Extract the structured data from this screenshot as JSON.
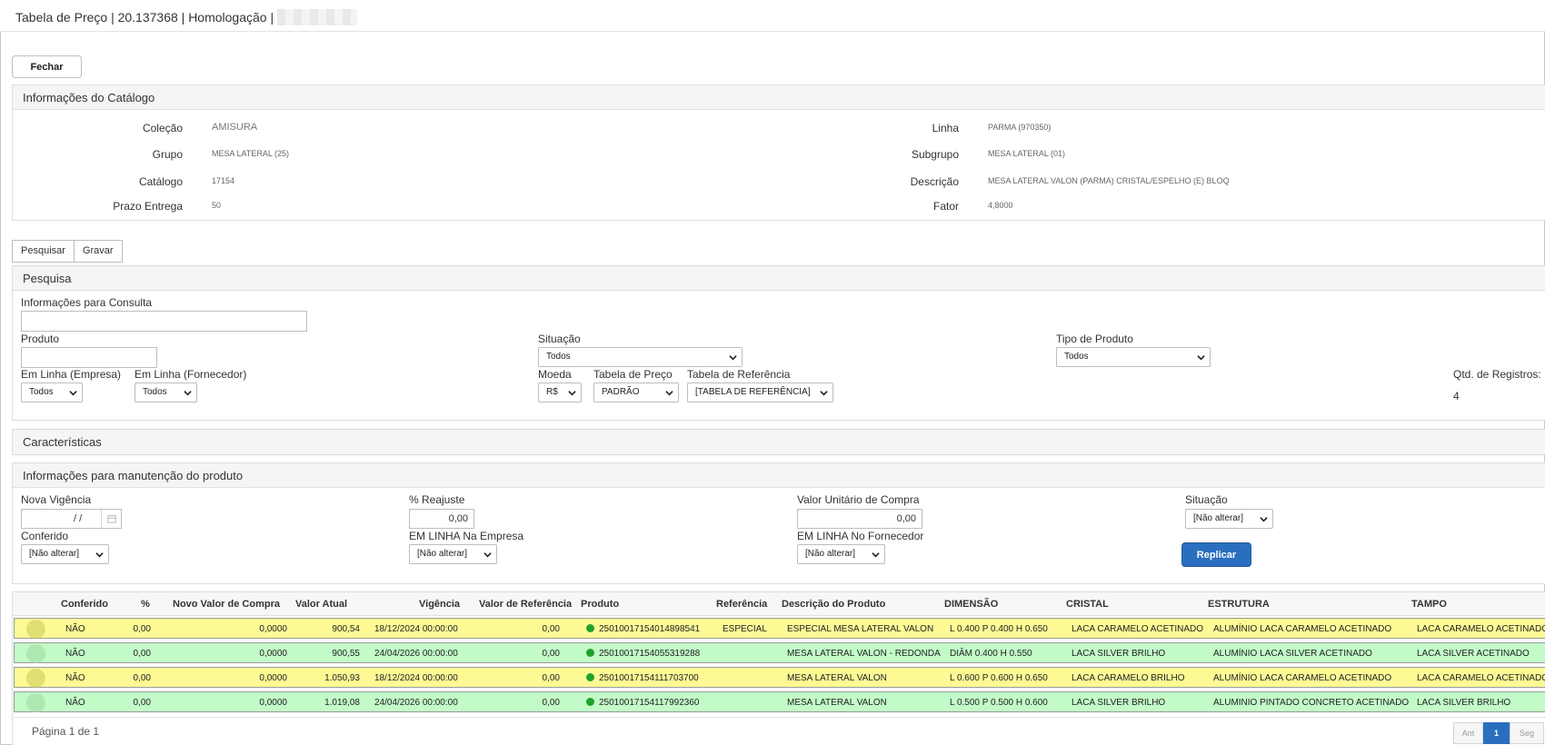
{
  "window": {
    "title": "Tabela de Preço | 20.137368 | Homologação |"
  },
  "buttons": {
    "fechar": "Fechar",
    "replicar": "Replicar"
  },
  "catalog": {
    "heading": "Informações do Catálogo",
    "left": [
      {
        "label": "Coleção",
        "value": "AMISURA"
      },
      {
        "label": "Grupo",
        "value": "MESA LATERAL (25)"
      },
      {
        "label": "Catálogo",
        "value": "17154"
      },
      {
        "label": "Prazo Entrega",
        "value": "50"
      }
    ],
    "right": [
      {
        "label": "Linha",
        "value": "PARMA (970350)"
      },
      {
        "label": "Subgrupo",
        "value": "MESA LATERAL (01)"
      },
      {
        "label": "Descrição",
        "value": "MESA LATERAL VALON (PARMA) CRISTAL/ESPELHO (E) BLOQ"
      },
      {
        "label": "Fator",
        "value": "4,8000"
      }
    ]
  },
  "tabs": [
    "Pesquisar",
    "Gravar"
  ],
  "search": {
    "heading": "Pesquisa",
    "info_label": "Informações para Consulta",
    "info_value": "",
    "produto_label": "Produto",
    "produto_value": "",
    "situacao_label": "Situação",
    "situacao_value": "Todos",
    "tipo_label": "Tipo de Produto",
    "tipo_value": "Todos",
    "em_linha_empresa_label": "Em Linha (Empresa)",
    "em_linha_empresa_value": "Todos",
    "em_linha_fornecedor_label": "Em Linha (Fornecedor)",
    "em_linha_fornecedor_value": "Todos",
    "moeda_label": "Moeda",
    "moeda_value": "R$",
    "tabela_preco_label": "Tabela de Preço",
    "tabela_preco_value": "PADRÃO",
    "tabela_ref_label": "Tabela de Referência",
    "tabela_ref_value": "[TABELA DE REFERÊNCIA]",
    "qtd_label": "Qtd. de Registros:",
    "qtd_value": "4"
  },
  "caracteristicas": {
    "heading": "Características"
  },
  "maintenance": {
    "heading": "Informações para manutenção do produto",
    "nova_vigencia_label": "Nova Vigência",
    "nova_vigencia_value": "/ /",
    "reajuste_label": "% Reajuste",
    "reajuste_value": "0,00",
    "valor_unit_label": "Valor Unitário de Compra",
    "valor_unit_value": "0,00",
    "situacao_label": "Situação",
    "situacao_value": "[Não alterar]",
    "conferido_label": "Conferido",
    "conferido_value": "[Não alterar]",
    "em_linha_empresa_label": "EM LINHA Na Empresa",
    "em_linha_empresa_value": "[Não alterar]",
    "em_linha_fornecedor_label": "EM LINHA No Fornecedor",
    "em_linha_fornecedor_value": "[Não alterar]"
  },
  "table": {
    "columns": [
      "Conferido",
      "%",
      "Novo Valor de Compra",
      "Valor Atual",
      "Vigência",
      "Valor de Referência",
      "Produto",
      "Referência",
      "Descrição do Produto",
      "DIMENSÃO",
      "CRISTAL",
      "ESTRUTURA",
      "TAMPO"
    ],
    "rows": [
      {
        "color": "yellow",
        "conferido": "NÃO",
        "pct": "0,00",
        "novo": "0,0000",
        "atual": "900,54",
        "vigencia": "18/12/2024 00:00:00",
        "ref_valor": "0,00",
        "produto": "25010017154014898541",
        "referencia": "ESPECIAL",
        "descricao": "ESPECIAL MESA LATERAL VALON",
        "dimensao": "L 0.400 P 0.400 H 0.650",
        "cristal": "LACA CARAMELO ACETINADO",
        "estrutura": "ALUMÍNIO LACA CARAMELO ACETINADO",
        "tampo": "LACA CARAMELO ACETINADO"
      },
      {
        "color": "green",
        "conferido": "NÃO",
        "pct": "0,00",
        "novo": "0,0000",
        "atual": "900,55",
        "vigencia": "24/04/2026 00:00:00",
        "ref_valor": "0,00",
        "produto": "25010017154055319288",
        "referencia": "",
        "descricao": "MESA LATERAL VALON - REDONDA",
        "dimensao": "DIÂM 0.400 H 0.550",
        "cristal": "LACA SILVER BRILHO",
        "estrutura": "ALUMÍNIO LACA SILVER ACETINADO",
        "tampo": "LACA SILVER ACETINADO"
      },
      {
        "color": "yellow",
        "conferido": "NÃO",
        "pct": "0,00",
        "novo": "0,0000",
        "atual": "1.050,93",
        "vigencia": "18/12/2024 00:00:00",
        "ref_valor": "0,00",
        "produto": "25010017154111703700",
        "referencia": "",
        "descricao": "MESA LATERAL VALON",
        "dimensao": "L 0.600 P 0.600 H 0.650",
        "cristal": "LACA CARAMELO BRILHO",
        "estrutura": "ALUMÍNIO LACA CARAMELO ACETINADO",
        "tampo": "LACA CARAMELO ACETINADO"
      },
      {
        "color": "green",
        "conferido": "NÃO",
        "pct": "0,00",
        "novo": "0,0000",
        "atual": "1.019,08",
        "vigencia": "24/04/2026 00:00:00",
        "ref_valor": "0,00",
        "produto": "25010017154117992360",
        "referencia": "",
        "descricao": "MESA LATERAL VALON",
        "dimensao": "L 0.500 P 0.500 H 0.600",
        "cristal": "LACA SILVER BRILHO",
        "estrutura": "ALUMINIO PINTADO CONCRETO ACETINADO",
        "tampo": "LACA SILVER BRILHO"
      }
    ]
  },
  "pager": {
    "info": "Página 1 de 1",
    "prev": "Ant",
    "current": "1",
    "next": "Seg"
  },
  "colors": {
    "yellow_row": "#fdfa96",
    "green_row": "#c2fbc7",
    "primary": "#2a6fbf",
    "status_dot": "#1fa22b"
  },
  "icons": [
    "magnifier-icon",
    "calendar-icon",
    "chevron-down-icon",
    "status-dot-icon"
  ]
}
